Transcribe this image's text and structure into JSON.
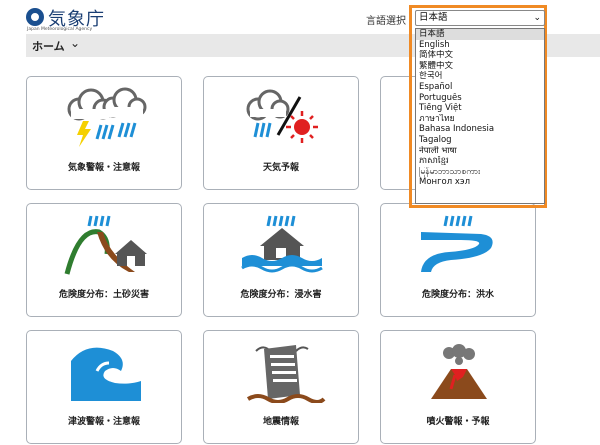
{
  "header": {
    "logo_title": "気象庁",
    "logo_subtitle": "Japan Meteorological Agency",
    "language_label": "言語選択"
  },
  "nav": {
    "home_label": "ホーム",
    "chevron": "⌄"
  },
  "language_select": {
    "selected": "日本語",
    "options": [
      "日本語",
      "English",
      "简体中文",
      "繁體中文",
      "한국어",
      "Español",
      "Português",
      "Tiếng Việt",
      "ภาษาไทย",
      "Bahasa Indonesia",
      "Tagalog",
      "नेपाली भाषा",
      "ភាសាខ្មែរ",
      "မြန်မာဘာသာစကား",
      "Монгол хэл"
    ]
  },
  "cards": [
    {
      "label": "気象警報・注意報",
      "icon": "storm-cloud-icon"
    },
    {
      "label": "天気予報",
      "icon": "rain-sun-icon"
    },
    {
      "label": "",
      "icon": "hidden-card"
    },
    {
      "label": "危険度分布：土砂災害",
      "icon": "landslide-icon"
    },
    {
      "label": "危険度分布：浸水害",
      "icon": "flooded-house-icon"
    },
    {
      "label": "危険度分布：洪水",
      "icon": "river-flood-icon"
    },
    {
      "label": "津波警報・注意報",
      "icon": "tsunami-wave-icon"
    },
    {
      "label": "地震情報",
      "icon": "earthquake-building-icon"
    },
    {
      "label": "噴火警報・予報",
      "icon": "volcano-icon"
    }
  ],
  "colors": {
    "accent": "#f08a24",
    "blue": "#1e8fd6",
    "brown": "#8b4a1c",
    "gray": "#666666",
    "green": "#2f7d2f",
    "red": "#e02020"
  }
}
